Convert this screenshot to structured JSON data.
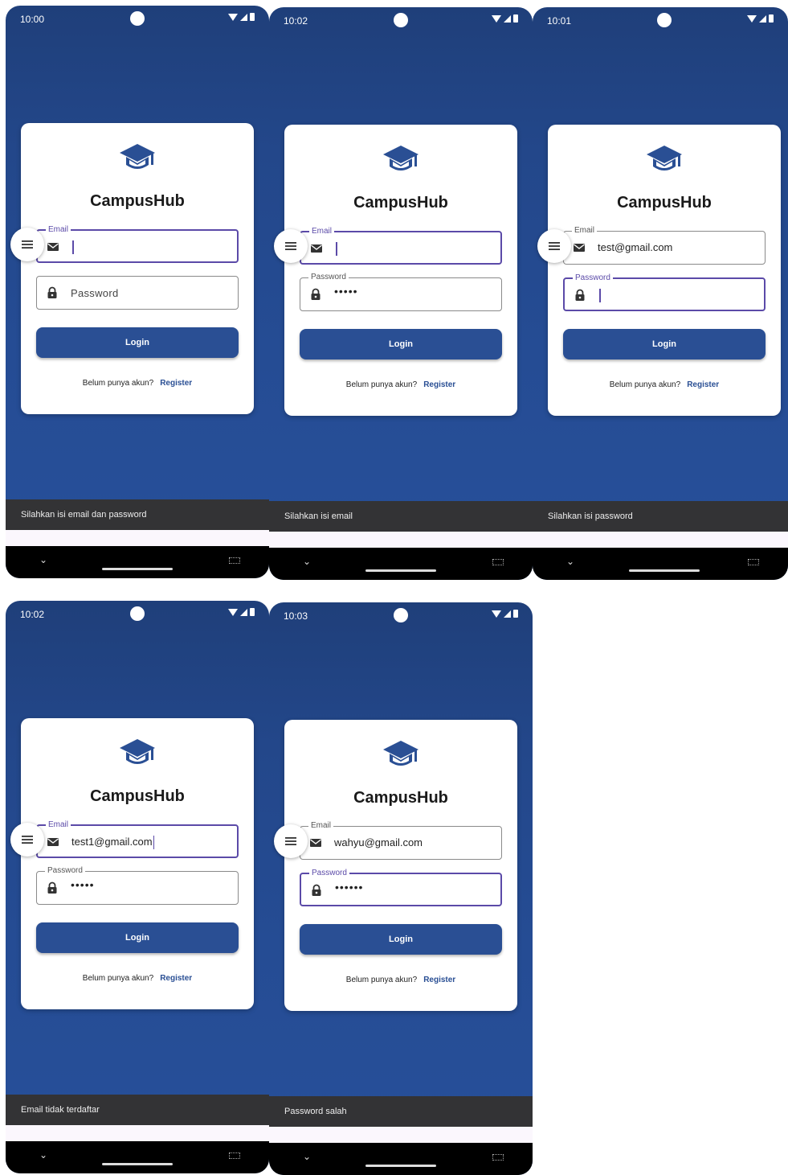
{
  "app_name": "CampusHub",
  "common": {
    "email_label": "Email",
    "password_label": "Password",
    "password_placeholder": "Password",
    "login_label": "Login",
    "register_prompt": "Belum punya akun?",
    "register_link": "Register",
    "password_mask": "•••••"
  },
  "colors": {
    "primary": "#2a4f94",
    "focus": "#5b4aa8",
    "background": "#254c94"
  },
  "icons": [
    "graduation-cap-icon",
    "mail-icon",
    "lock-icon",
    "menu-icon",
    "wifi-icon",
    "signal-icon",
    "battery-icon",
    "chevron-down-icon",
    "keyboard-icon"
  ],
  "screens": [
    {
      "time": "10:00",
      "email_value": "",
      "password_value": "",
      "snackbar": "Silahkan isi email dan password"
    },
    {
      "time": "10:02",
      "email_value": "",
      "password_value": "•••••",
      "snackbar": "Silahkan isi email"
    },
    {
      "time": "10:01",
      "email_value": "test@gmail.com",
      "password_value": "",
      "snackbar": "Silahkan isi password"
    },
    {
      "time": "10:02",
      "email_value": "test1@gmail.com",
      "password_value": "•••••",
      "snackbar": "Email tidak terdaftar"
    },
    {
      "time": "10:03",
      "email_value": "wahyu@gmail.com",
      "password_value": "••••••",
      "snackbar": "Password salah"
    }
  ]
}
